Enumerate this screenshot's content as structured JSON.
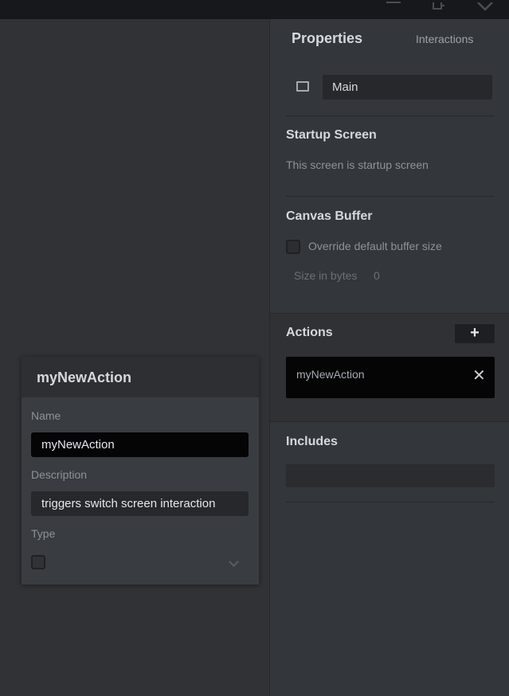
{
  "panel": {
    "tabs": {
      "properties": "Properties",
      "interactions": "Interactions"
    },
    "screen_name": "Main",
    "startup": {
      "title": "Startup Screen",
      "text": "This screen is startup screen"
    },
    "canvas_buffer": {
      "title": "Canvas Buffer",
      "override_label": "Override default buffer size",
      "size_label": "Size in bytes",
      "size_value": "0"
    },
    "actions": {
      "title": "Actions",
      "add_label": "+",
      "items": [
        {
          "label": "myNewAction",
          "remove": "✕"
        }
      ]
    },
    "includes": {
      "title": "Includes"
    }
  },
  "editor": {
    "title": "myNewAction",
    "name_label": "Name",
    "name_value": "myNewAction",
    "description_label": "Description",
    "description_value": "triggers switch screen interaction",
    "type_label": "Type"
  },
  "colors": {
    "background": "#303236",
    "panel": "#33363a",
    "dark_field": "#050506",
    "text": "#d5d8dc"
  }
}
